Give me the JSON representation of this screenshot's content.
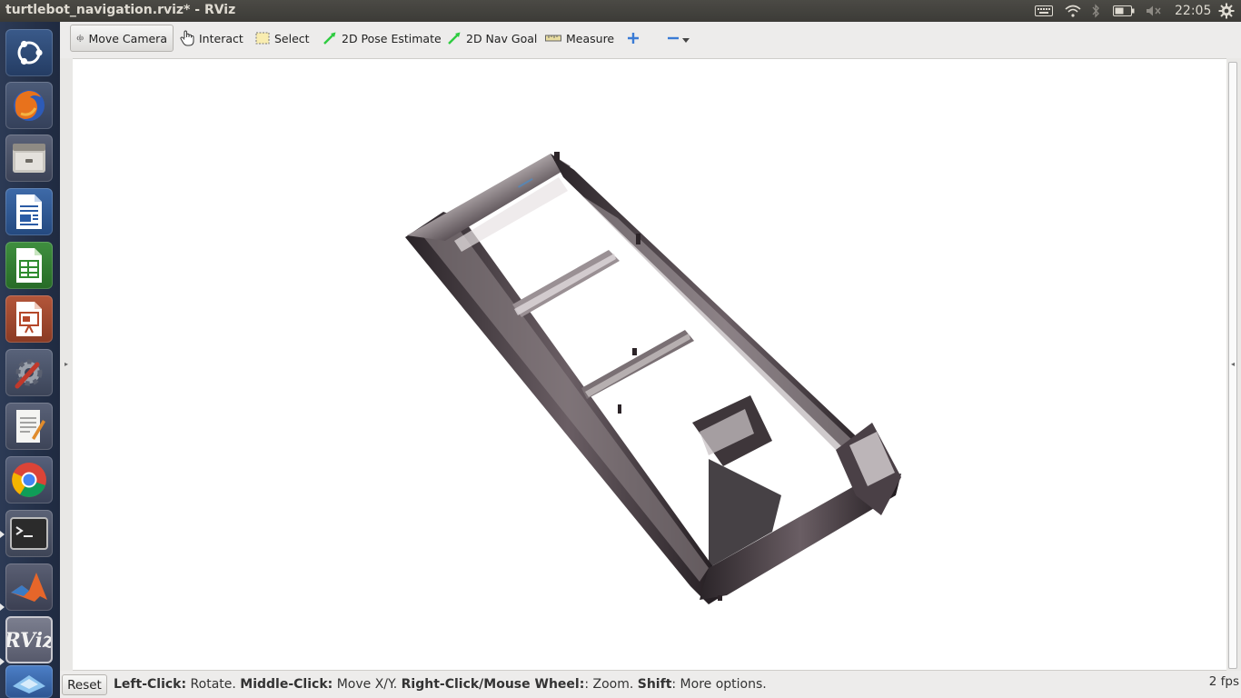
{
  "window": {
    "title": "turtlebot_navigation.rviz* - RViz"
  },
  "panel": {
    "clock": "22:05"
  },
  "launcher": {
    "apps": [
      {
        "name": "dash-home-icon"
      },
      {
        "name": "firefox-icon"
      },
      {
        "name": "files-icon"
      },
      {
        "name": "libreoffice-writer-icon"
      },
      {
        "name": "libreoffice-calc-icon"
      },
      {
        "name": "libreoffice-impress-icon"
      },
      {
        "name": "system-settings-icon"
      },
      {
        "name": "text-editor-icon"
      },
      {
        "name": "chrome-icon"
      },
      {
        "name": "terminal-icon"
      },
      {
        "name": "matlab-icon"
      },
      {
        "name": "rviz-icon",
        "label": "RViz"
      },
      {
        "name": "gazebo-icon"
      }
    ]
  },
  "toolbar": {
    "move_camera": "Move Camera",
    "interact": "Interact",
    "select": "Select",
    "pose_estimate": "2D Pose Estimate",
    "nav_goal": "2D Nav Goal",
    "measure": "Measure"
  },
  "status": {
    "reset": "Reset",
    "left_click_key": "Left-Click:",
    "left_click_desc": " Rotate. ",
    "middle_click_key": "Middle-Click:",
    "middle_click_desc": " Move X/Y. ",
    "right_click_key": "Right-Click/Mouse Wheel:",
    "right_click_desc": ": Zoom. ",
    "shift_key": "Shift",
    "shift_desc": ": More options.",
    "fps": "2 fps"
  },
  "colors": {
    "pointcloud_dark": "#2a2428",
    "pointcloud_light": "#b8b0b2",
    "accent_green": "#2ecc40"
  }
}
